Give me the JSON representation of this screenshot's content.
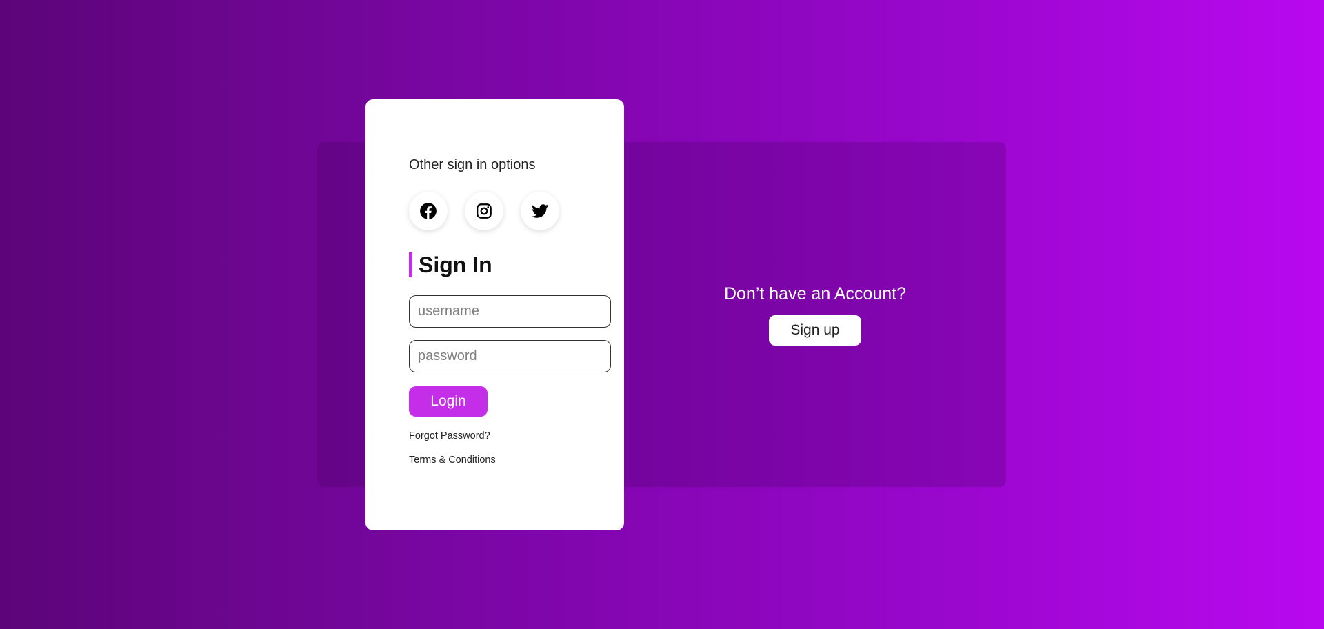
{
  "colors": {
    "accent": "#c52ee9",
    "background_start": "#5c0578",
    "background_end": "#b908ef",
    "card": "#ffffff"
  },
  "signin": {
    "other_options_label": "Other sign in options",
    "social_buttons": [
      {
        "name": "facebook",
        "icon": "facebook-icon"
      },
      {
        "name": "instagram",
        "icon": "instagram-icon"
      },
      {
        "name": "twitter",
        "icon": "twitter-icon"
      }
    ],
    "heading": "Sign In",
    "username": {
      "placeholder": "username",
      "value": ""
    },
    "password": {
      "placeholder": "password",
      "value": ""
    },
    "login_label": "Login",
    "forgot_password_label": "Forgot Password?",
    "terms_label": "Terms & Conditions"
  },
  "signup": {
    "question": "Don’t have an Account?",
    "button_label": "Sign up"
  }
}
